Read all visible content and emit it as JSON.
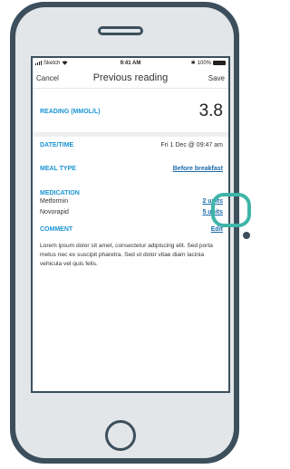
{
  "statusbar": {
    "carrier": "Sketch",
    "time": "9:41 AM",
    "battery": "100%"
  },
  "navbar": {
    "cancel": "Cancel",
    "title": "Previous reading",
    "save": "Save"
  },
  "reading": {
    "label": "READING (MMOL/L)",
    "value": "3.8"
  },
  "datetime": {
    "label": "DATE/TIME",
    "value": "Fri 1 Dec @ 09:47 am"
  },
  "meal": {
    "label": "MEAL TYPE",
    "value": "Before breakfast"
  },
  "medication": {
    "label": "MEDICATION",
    "items": [
      {
        "name": "Metformin",
        "dose": "2 units"
      },
      {
        "name": "Novorapid",
        "dose": "5 units"
      }
    ]
  },
  "comment": {
    "label": "COMMENT",
    "edit": "Edit",
    "text": "Lorem ipsum dolor sit amet, consectetur adipiscing elit. Sed porta metus nec ex suscipit pharetra. Sed ut dolor vitae diam lacinia vehicula vel quis felis."
  },
  "colors": {
    "accent": "#1a95d4",
    "frame": "#3d4f5c",
    "highlight": "#3fb5a8"
  }
}
